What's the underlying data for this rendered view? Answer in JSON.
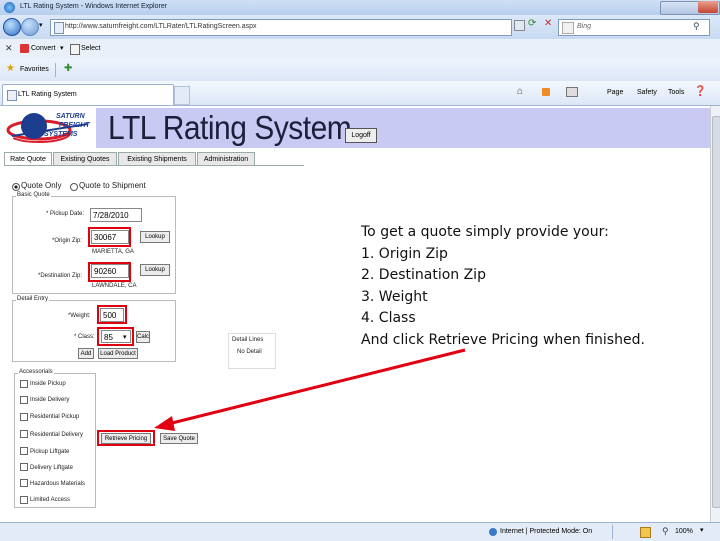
{
  "browser": {
    "window_title": "LTL Rating System - Windows Internet Explorer",
    "address_url": "http://www.saturnfreight.com/LTLRater/LTLRatingScreen.aspx",
    "search_engine": "Bing",
    "command_bar": {
      "convert_label": "Convert",
      "select_label": "Select"
    },
    "favorites_label": "Favorites",
    "tab_title": "LTL Rating System",
    "tools": {
      "page_label": "Page",
      "safety_label": "Safety",
      "tools_label": "Tools"
    },
    "status": {
      "zone": "Internet | Protected Mode: On",
      "zoom": "100%"
    }
  },
  "app": {
    "logo_text": [
      "SATURN",
      "FREIGHT",
      "SYSTEMS"
    ],
    "title": "LTL Rating System",
    "logoff_label": "Logoff",
    "tabs": [
      "Rate Quote",
      "Existing Quotes",
      "Existing Shipments",
      "Administration"
    ],
    "radio_options": [
      "Quote Only",
      "Quote to Shipment"
    ],
    "basic_quote": {
      "group_label": "Basic Quote",
      "pickup_date_label": "* Pickup Date:",
      "pickup_date_value": "7/28/2010",
      "origin_zip_label": "*Origin Zip:",
      "origin_zip_value": "30067",
      "origin_city": "MARIETTA, GA",
      "destination_zip_label": "*Destination Zip:",
      "destination_zip_value": "90260",
      "destination_city": "LAWNDALE, CA",
      "lookup_label": "Lookup"
    },
    "detail_entry": {
      "group_label": "Detail Entry",
      "weight_label": "*Weight:",
      "weight_value": "500",
      "class_label": "* Class:",
      "class_value": "85",
      "calc_label": "Calc",
      "add_label": "Add",
      "load_product_label": "Load Product"
    },
    "detail_lines": {
      "title": "Detail Lines",
      "empty_text": "No Detail"
    },
    "accessorials": {
      "group_label": "Accessorials",
      "items": [
        "Inside Pickup",
        "Inside Delivery",
        "Residential Pickup",
        "Residential Delivery",
        "Pickup Liftgate",
        "Delivery Liftgate",
        "Hazardous Materials",
        "Limited Access"
      ]
    },
    "retrieve_pricing_label": "Retrieve Pricing",
    "save_quote_label": "Save Quote"
  },
  "instructions": {
    "lines": [
      "To get a quote simply provide your:",
      "1.  Origin Zip",
      "2.  Destination Zip",
      "3.  Weight",
      "4.  Class",
      "And click Retrieve Pricing when finished."
    ]
  },
  "colors": {
    "highlight": "#e00010",
    "banner": "#c9caf3",
    "logo_red": "#d81e2c",
    "logo_blue": "#1d3d8f"
  }
}
